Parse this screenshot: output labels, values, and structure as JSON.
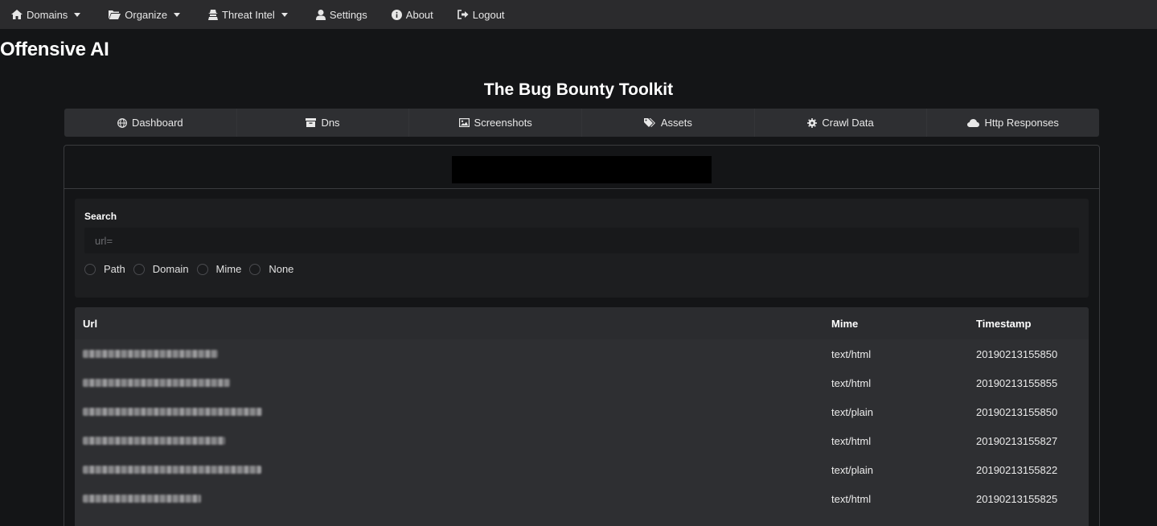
{
  "nav": {
    "items": [
      {
        "label": "Domains",
        "icon": "home-icon",
        "dropdown": true
      },
      {
        "label": "Organize",
        "icon": "folder-icon",
        "dropdown": true
      },
      {
        "label": "Threat Intel",
        "icon": "spy-icon",
        "dropdown": true
      },
      {
        "label": "Settings",
        "icon": "user-icon",
        "dropdown": false
      },
      {
        "label": "About",
        "icon": "info-icon",
        "dropdown": false
      },
      {
        "label": "Logout",
        "icon": "logout-icon",
        "dropdown": false
      }
    ]
  },
  "brand": "Offensive AI",
  "subtitle": "The Bug Bounty Toolkit",
  "tabs": [
    {
      "label": "Dashboard",
      "icon": "globe-icon"
    },
    {
      "label": "Dns",
      "icon": "archive-icon"
    },
    {
      "label": "Screenshots",
      "icon": "image-icon"
    },
    {
      "label": "Assets",
      "icon": "tags-icon"
    },
    {
      "label": "Crawl Data",
      "icon": "gear-icon"
    },
    {
      "label": "Http Responses",
      "icon": "cloud-icon"
    }
  ],
  "search": {
    "label": "Search",
    "placeholder": "url=",
    "options": [
      "Path",
      "Domain",
      "Mime",
      "None"
    ]
  },
  "table": {
    "headers": {
      "url": "Url",
      "mime": "Mime",
      "timestamp": "Timestamp"
    },
    "rows": [
      {
        "mime": "text/html",
        "timestamp": "20190213155850"
      },
      {
        "mime": "text/html",
        "timestamp": "20190213155855"
      },
      {
        "mime": "text/plain",
        "timestamp": "20190213155850"
      },
      {
        "mime": "text/html",
        "timestamp": "20190213155827"
      },
      {
        "mime": "text/plain",
        "timestamp": "20190213155822"
      },
      {
        "mime": "text/html",
        "timestamp": "20190213155825"
      }
    ]
  },
  "colors": {
    "background": "#141517",
    "nav": "#2b2b2d",
    "panel": "#2e2f32"
  }
}
